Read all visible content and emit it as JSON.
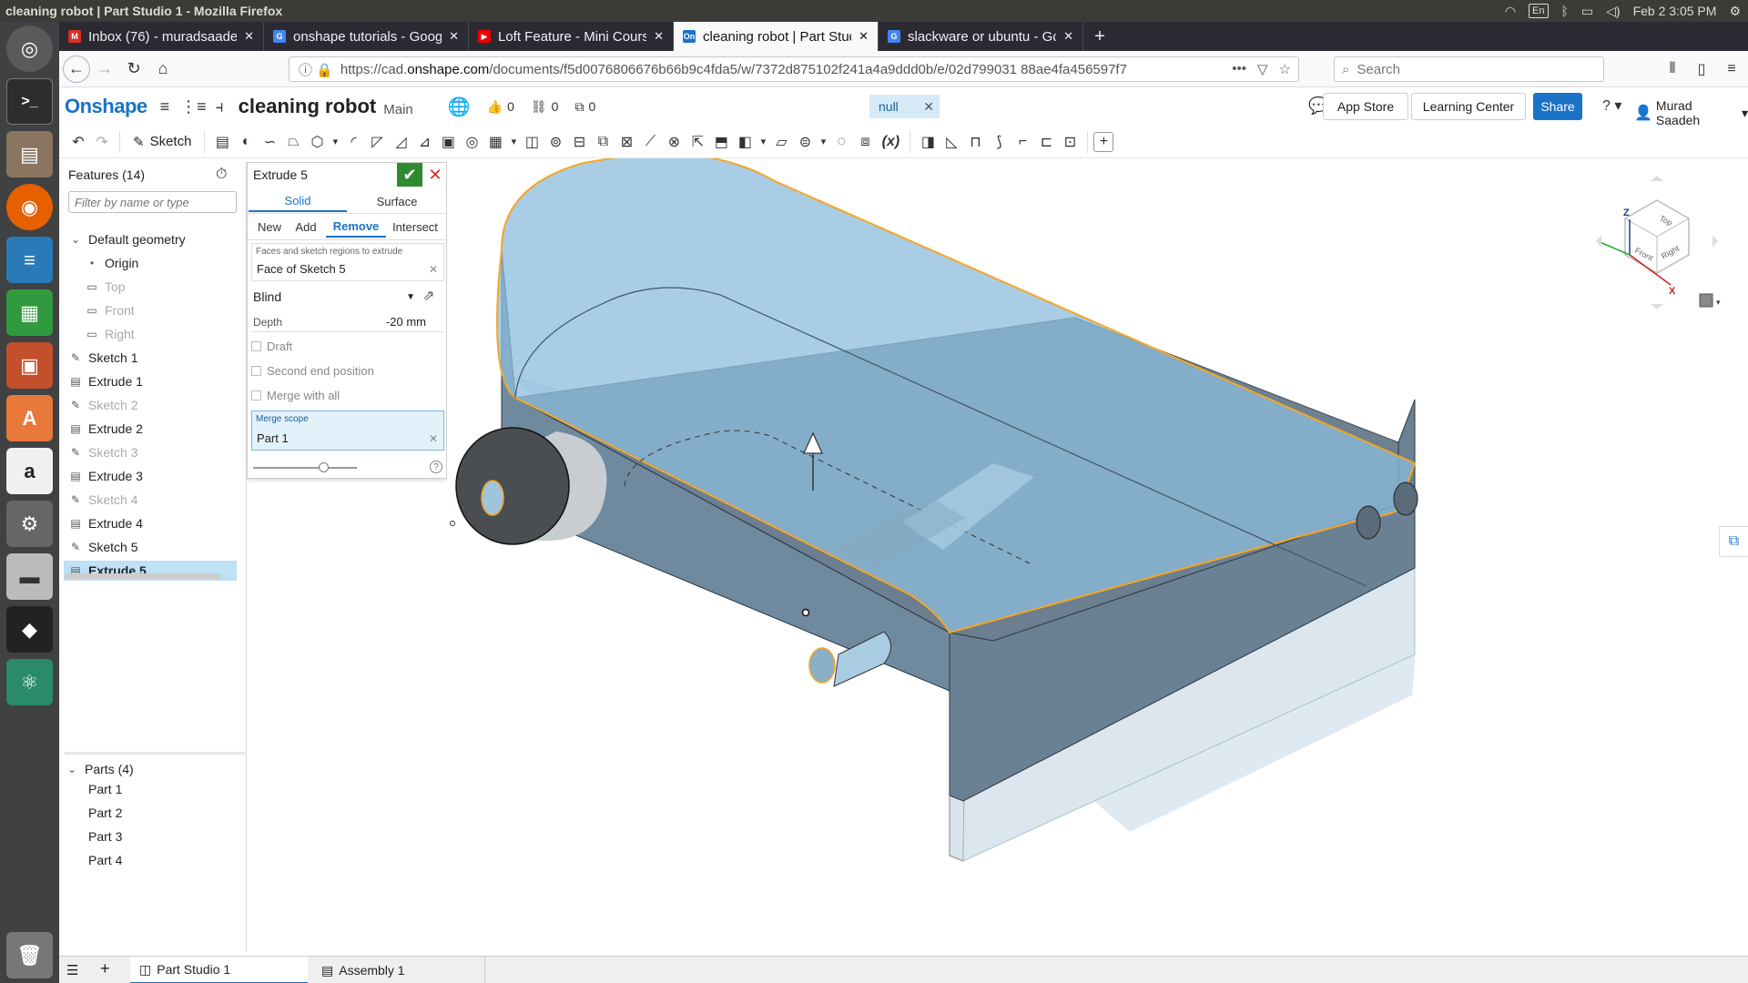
{
  "window": {
    "title": "cleaning robot | Part Studio 1 - Mozilla Firefox",
    "date": "Feb 2",
    "time": "3:05 PM",
    "keyboard_layout": "En"
  },
  "tabs": [
    {
      "label": "Inbox (76) - muradsaadeh",
      "favicon_color": "#d93025",
      "favicon": "M",
      "close": "✕"
    },
    {
      "label": "onshape tutorials - Google",
      "favicon_color": "#4285f4",
      "favicon": "G",
      "close": "✕"
    },
    {
      "label": "Loft Feature - Mini Course",
      "favicon_color": "#e00",
      "favicon": "▶",
      "close": "✕"
    },
    {
      "label": "cleaning robot | Part Studio",
      "favicon_color": "#1a73c7",
      "favicon": "On",
      "close": "✕",
      "active": true
    },
    {
      "label": "slackware or ubuntu - Google",
      "favicon_color": "#4285f4",
      "favicon": "G",
      "close": "✕"
    }
  ],
  "new_tab": "+",
  "url": {
    "prefix": "https://cad.",
    "host": "onshape.com",
    "path": "/documents/f5d0076806676b66b9c4fda5/w/7372d875102f241a4a9ddd0b/e/02d799031 88ae4fa456597f7"
  },
  "search_placeholder": "Search",
  "onshape": {
    "logo": "Onshape",
    "doc_title": "cleaning robot",
    "branch": "Main",
    "likes": "0",
    "links": "0",
    "copies": "0",
    "null_chip": "null",
    "app_store": "App Store",
    "learning_center": "Learning Center",
    "share": "Share",
    "help": "?",
    "user": "Murad Saadeh"
  },
  "toolbar": {
    "sketch_label": "Sketch",
    "variable_label": "(x)"
  },
  "features": {
    "header": "Features (14)",
    "filter_placeholder": "Filter by name or type",
    "items": [
      {
        "label": "Default geometry",
        "icon": "chevron-down-icon",
        "glyph": "⌄",
        "indent": 0,
        "state": "normal"
      },
      {
        "label": "Origin",
        "icon": "origin-icon",
        "glyph": "•",
        "indent": 1,
        "state": "normal"
      },
      {
        "label": "Top",
        "icon": "plane-icon",
        "glyph": "▭",
        "indent": 1,
        "state": "dim"
      },
      {
        "label": "Front",
        "icon": "plane-icon",
        "glyph": "▭",
        "indent": 1,
        "state": "dim"
      },
      {
        "label": "Right",
        "icon": "plane-icon",
        "glyph": "▭",
        "indent": 1,
        "state": "dim"
      },
      {
        "label": "Sketch 1",
        "icon": "sketch-icon",
        "glyph": "✎",
        "indent": 0,
        "state": "normal"
      },
      {
        "label": "Extrude 1",
        "icon": "extrude-icon",
        "glyph": "▤",
        "indent": 0,
        "state": "normal"
      },
      {
        "label": "Sketch 2",
        "icon": "sketch-icon",
        "glyph": "✎",
        "indent": 0,
        "state": "dim"
      },
      {
        "label": "Extrude 2",
        "icon": "extrude-icon",
        "glyph": "▤",
        "indent": 0,
        "state": "normal"
      },
      {
        "label": "Sketch 3",
        "icon": "sketch-icon",
        "glyph": "✎",
        "indent": 0,
        "state": "dim"
      },
      {
        "label": "Extrude 3",
        "icon": "extrude-icon",
        "glyph": "▤",
        "indent": 0,
        "state": "normal"
      },
      {
        "label": "Sketch 4",
        "icon": "sketch-icon",
        "glyph": "✎",
        "indent": 0,
        "state": "dim"
      },
      {
        "label": "Extrude 4",
        "icon": "extrude-icon",
        "glyph": "▤",
        "indent": 0,
        "state": "normal"
      },
      {
        "label": "Sketch 5",
        "icon": "sketch-icon",
        "glyph": "✎",
        "indent": 0,
        "state": "normal"
      },
      {
        "label": "Extrude 5",
        "icon": "extrude-icon",
        "glyph": "▤",
        "indent": 0,
        "state": "selected"
      }
    ]
  },
  "parts": {
    "header": "Parts (4)",
    "items": [
      "Part 1",
      "Part 2",
      "Part 3",
      "Part 4"
    ]
  },
  "extrude_dialog": {
    "title": "Extrude 5",
    "tab_solid": "Solid",
    "tab_surface": "Surface",
    "op_new": "New",
    "op_add": "Add",
    "op_remove": "Remove",
    "op_intersect": "Intersect",
    "faces_label": "Faces and sketch regions to extrude",
    "faces_value": "Face of Sketch 5",
    "end_type": "Blind",
    "depth_label": "Depth",
    "depth_value": "-20 mm",
    "draft": "Draft",
    "second_end": "Second end position",
    "merge_with_all": "Merge with all",
    "merge_scope_label": "Merge scope",
    "merge_scope_value": "Part 1",
    "slider_level": 0.68
  },
  "view_cube": {
    "top": "Top",
    "front": "Front",
    "right": "Right",
    "z": "Z",
    "x": "X"
  },
  "bottom_tabs": [
    {
      "label": "Part Studio 1",
      "active": true
    },
    {
      "label": "Assembly 1",
      "active": false
    }
  ],
  "colors": {
    "onshape_blue": "#1a73c7",
    "selection": "#bfe0f5",
    "part_blue": "#8cbcdc",
    "edge_orange": "#f5a623"
  }
}
